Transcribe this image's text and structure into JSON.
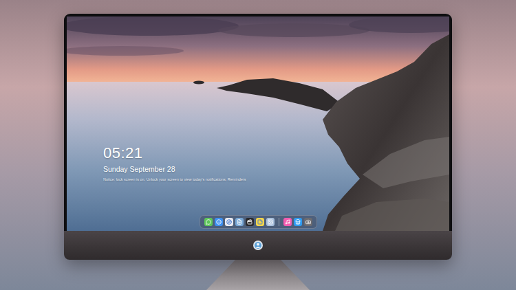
{
  "lock_screen": {
    "time": "05:21",
    "date": "Sunday September 28",
    "notice": "Notice: lock screen is on. Unlock your screen to view today's notifications. Reminders"
  },
  "dock": [
    {
      "kind": "app",
      "color": "#5ec65a"
    },
    {
      "kind": "app",
      "color": "#3d8ff0"
    },
    {
      "kind": "app",
      "color": "#e9e9ef"
    },
    {
      "kind": "app",
      "color": "#79a8d6"
    },
    {
      "kind": "app",
      "color": "#2b2b2e"
    },
    {
      "kind": "app",
      "color": "#f5d54a"
    },
    {
      "kind": "app",
      "color": "#a9c0dc"
    },
    {
      "kind": "separator",
      "color": "#cfd2da"
    },
    {
      "kind": "app",
      "color": "#f25cb0"
    },
    {
      "kind": "app",
      "color": "#2f9bf0"
    },
    {
      "kind": "app",
      "color": "#6b6b70"
    }
  ]
}
